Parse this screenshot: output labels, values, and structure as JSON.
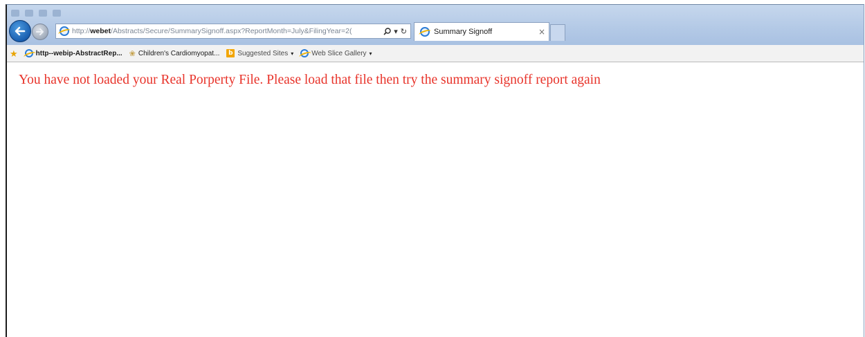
{
  "window": {
    "title": "Summary Signoff"
  },
  "address_bar": {
    "url_prefix": "http://",
    "url_host": "webet",
    "url_path": "/Abstracts/Secure/SummarySignoff.aspx?ReportMonth=July&FilingYear=2("
  },
  "tabs": [
    {
      "title": "Summary Signoff",
      "close": "×"
    }
  ],
  "favorites": [
    {
      "label": "http--webip-AbstractRep...",
      "icon": "ie-page-icon"
    },
    {
      "label": "Children's Cardiomyopat...",
      "icon": "leaf-icon"
    },
    {
      "label": "Suggested Sites",
      "icon": "bing-icon",
      "dropdown": true
    },
    {
      "label": "Web Slice Gallery",
      "icon": "ie-page-icon",
      "dropdown": true
    }
  ],
  "page": {
    "message": "You have not loaded your Real Porperty File. Please load that file then try the summary signoff report again",
    "message_color": "#e8332a"
  },
  "glyphs": {
    "back": "🡠",
    "forward": "→",
    "search": "⌕",
    "dropdown": "▾",
    "refresh": "↻",
    "star": "★",
    "leaf": "❀",
    "bing": "b"
  }
}
